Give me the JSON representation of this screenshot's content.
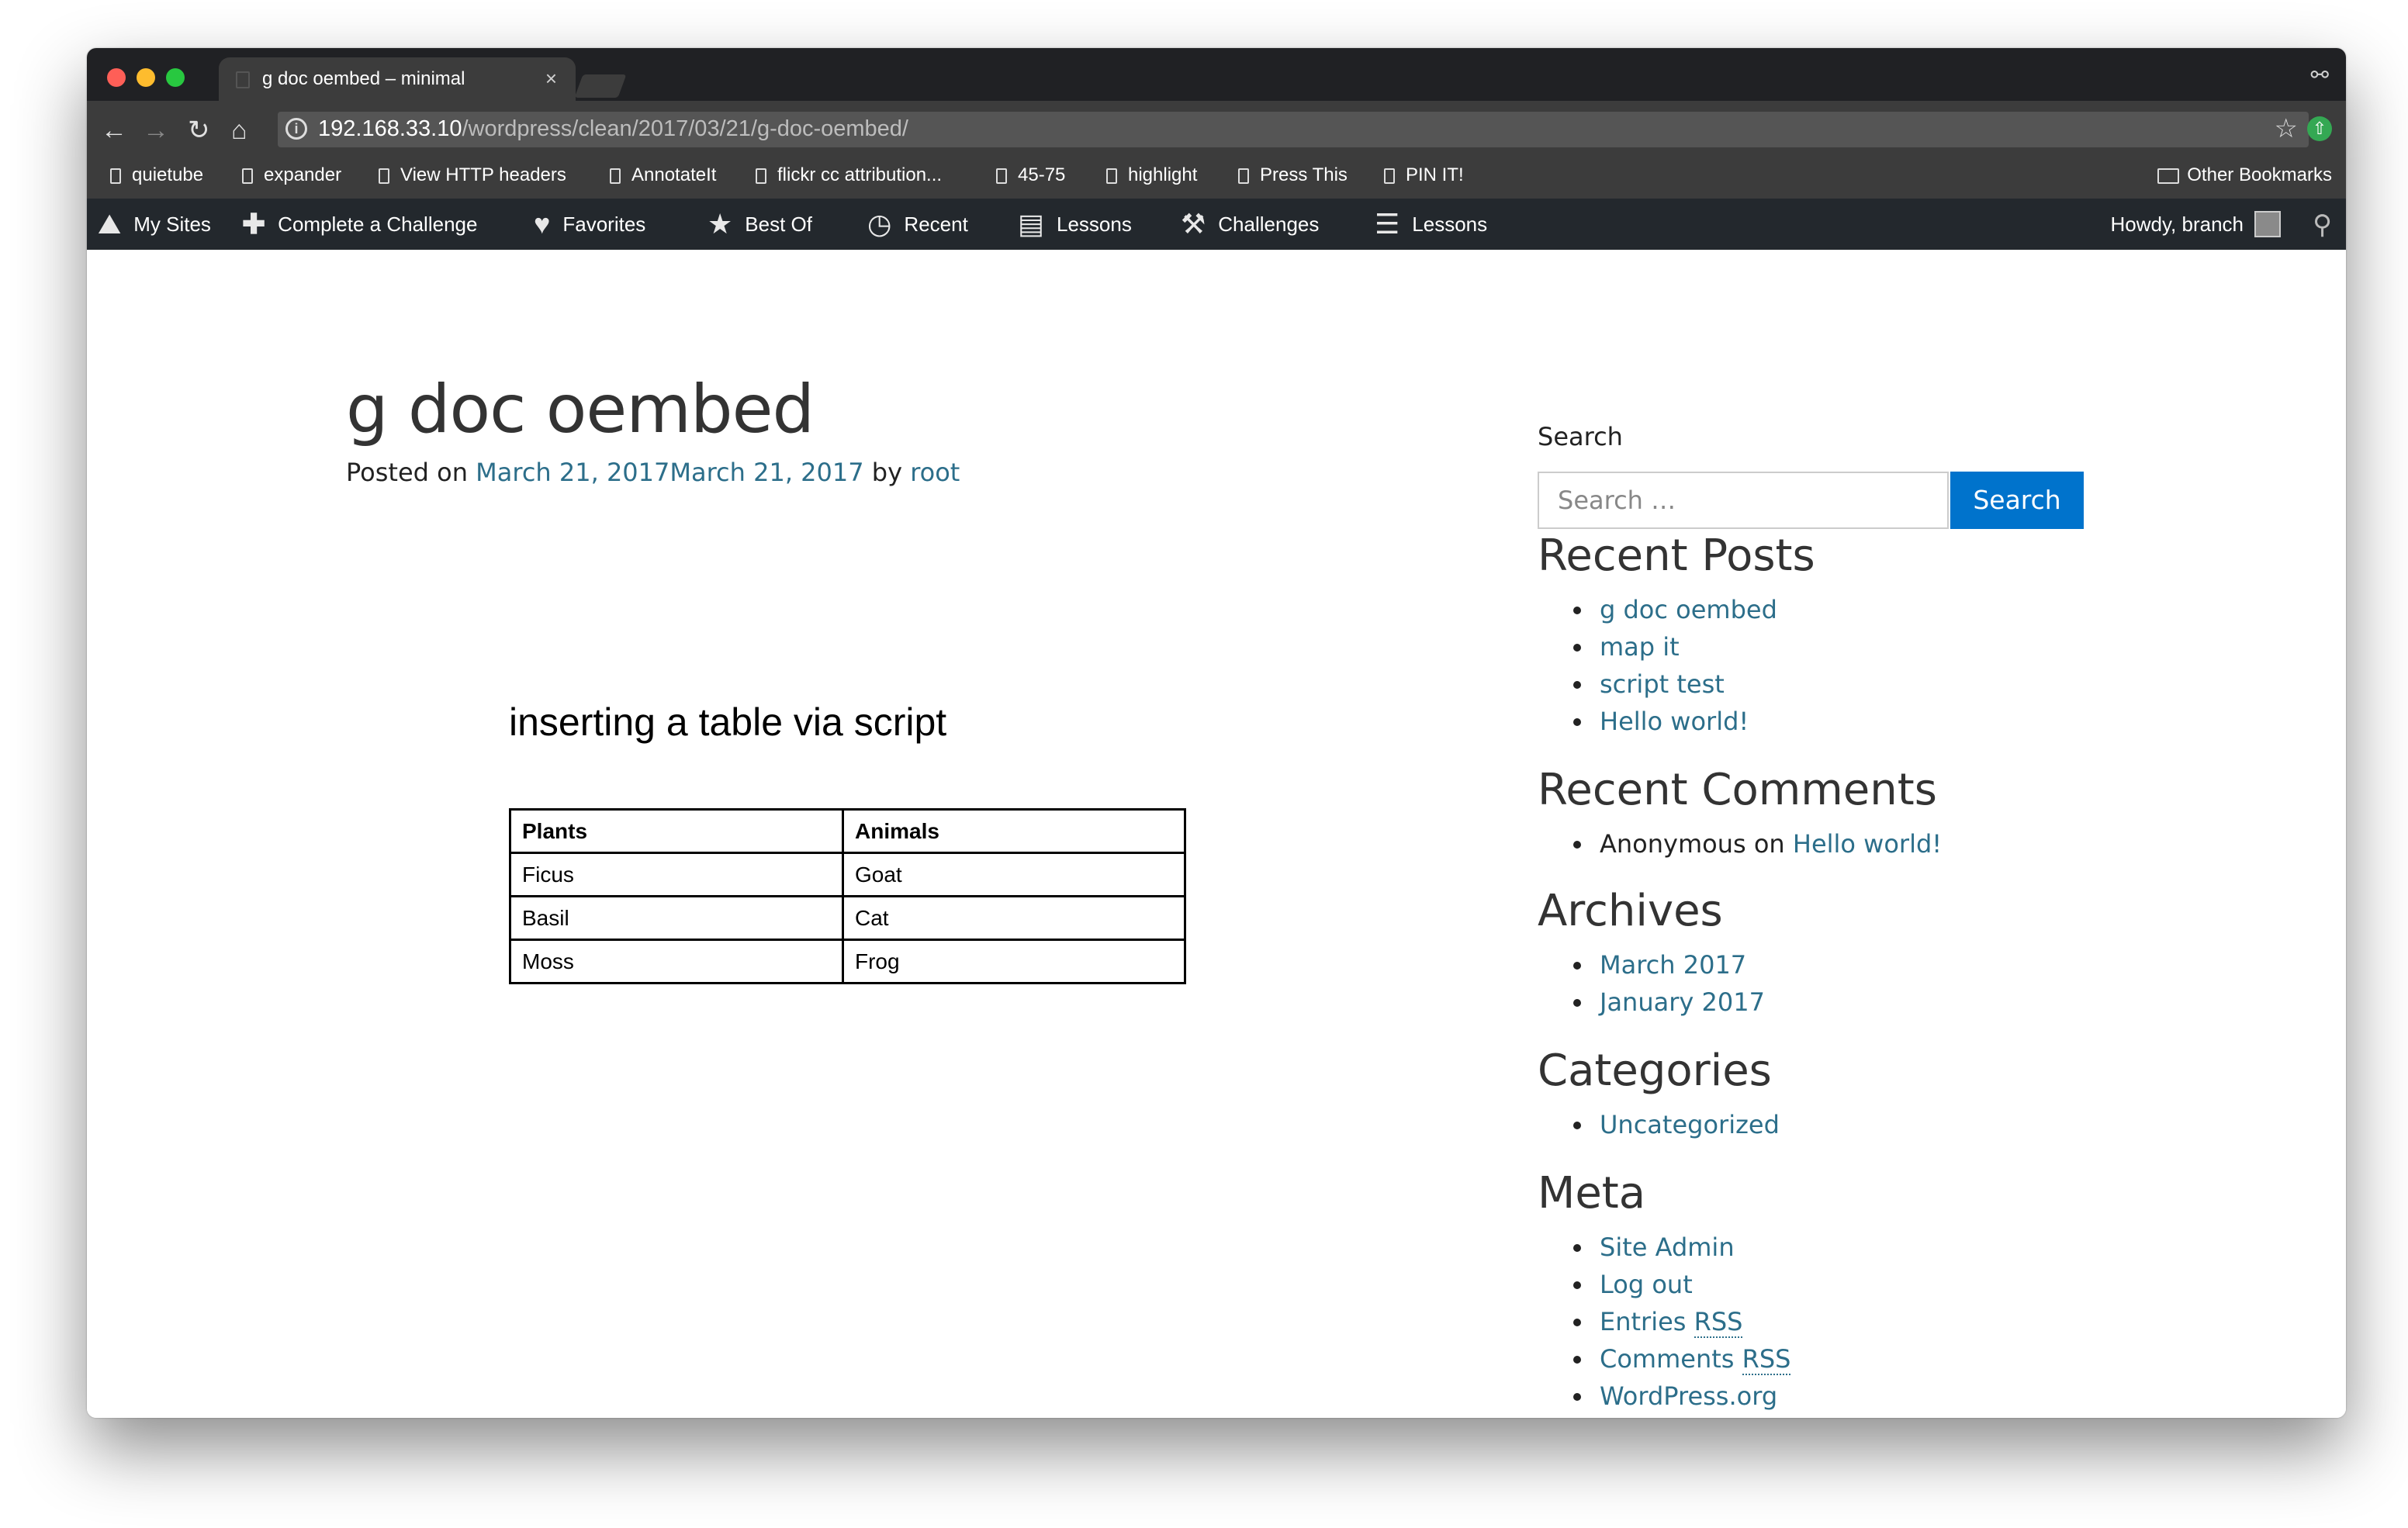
{
  "browser": {
    "tab_title": "g doc oembed – minimal",
    "tab_close": "×",
    "url_host": "192.168.33.10",
    "url_path": "/wordpress/clean/2017/03/21/g-doc-oembed/",
    "icons": [
      "back-icon",
      "forward-icon",
      "reload-icon",
      "home-icon",
      "info-icon",
      "star-icon",
      "extension-icon",
      "incognito-icon"
    ]
  },
  "bookmarks": {
    "items": [
      "quietube",
      "expander",
      "View HTTP headers",
      "AnnotateIt",
      "flickr cc attribution...",
      "45-75",
      "highlight",
      "Press This",
      "PIN IT!"
    ],
    "other": "Other Bookmarks"
  },
  "adminbar": {
    "items": [
      "My Sites",
      "Complete a Challenge",
      "Favorites",
      "Best Of",
      "Recent",
      "Lessons",
      "Challenges",
      "Lessons"
    ],
    "howdy": "Howdy, branch"
  },
  "post": {
    "title": "g doc oembed",
    "posted_on": "Posted on",
    "date": "March 21, 2017March 21, 2017",
    "by": "by",
    "author": "root"
  },
  "embed": {
    "heading": "inserting a table via script",
    "headers": [
      "Plants",
      "Animals"
    ],
    "rows": [
      [
        "Ficus",
        "Goat"
      ],
      [
        "Basil",
        "Cat"
      ],
      [
        "Moss",
        "Frog"
      ]
    ]
  },
  "sidebar": {
    "search_label": "Search",
    "search_placeholder": "Search …",
    "search_button": "Search",
    "recent_posts_title": "Recent Posts",
    "recent_posts": [
      "g doc oembed",
      "map it",
      "script test",
      "Hello world!"
    ],
    "recent_comments_title": "Recent Comments",
    "comment_author": "Anonymous",
    "comment_on": "on",
    "comment_post": "Hello world!",
    "archives_title": "Archives",
    "archives": [
      "March 2017",
      "January 2017"
    ],
    "categories_title": "Categories",
    "categories": [
      "Uncategorized"
    ],
    "meta_title": "Meta",
    "meta_admin": "Site Admin",
    "meta_logout": "Log out",
    "meta_entries": "Entries",
    "meta_comments": "Comments",
    "meta_rss": "RSS",
    "meta_wporg": "WordPress.org"
  }
}
